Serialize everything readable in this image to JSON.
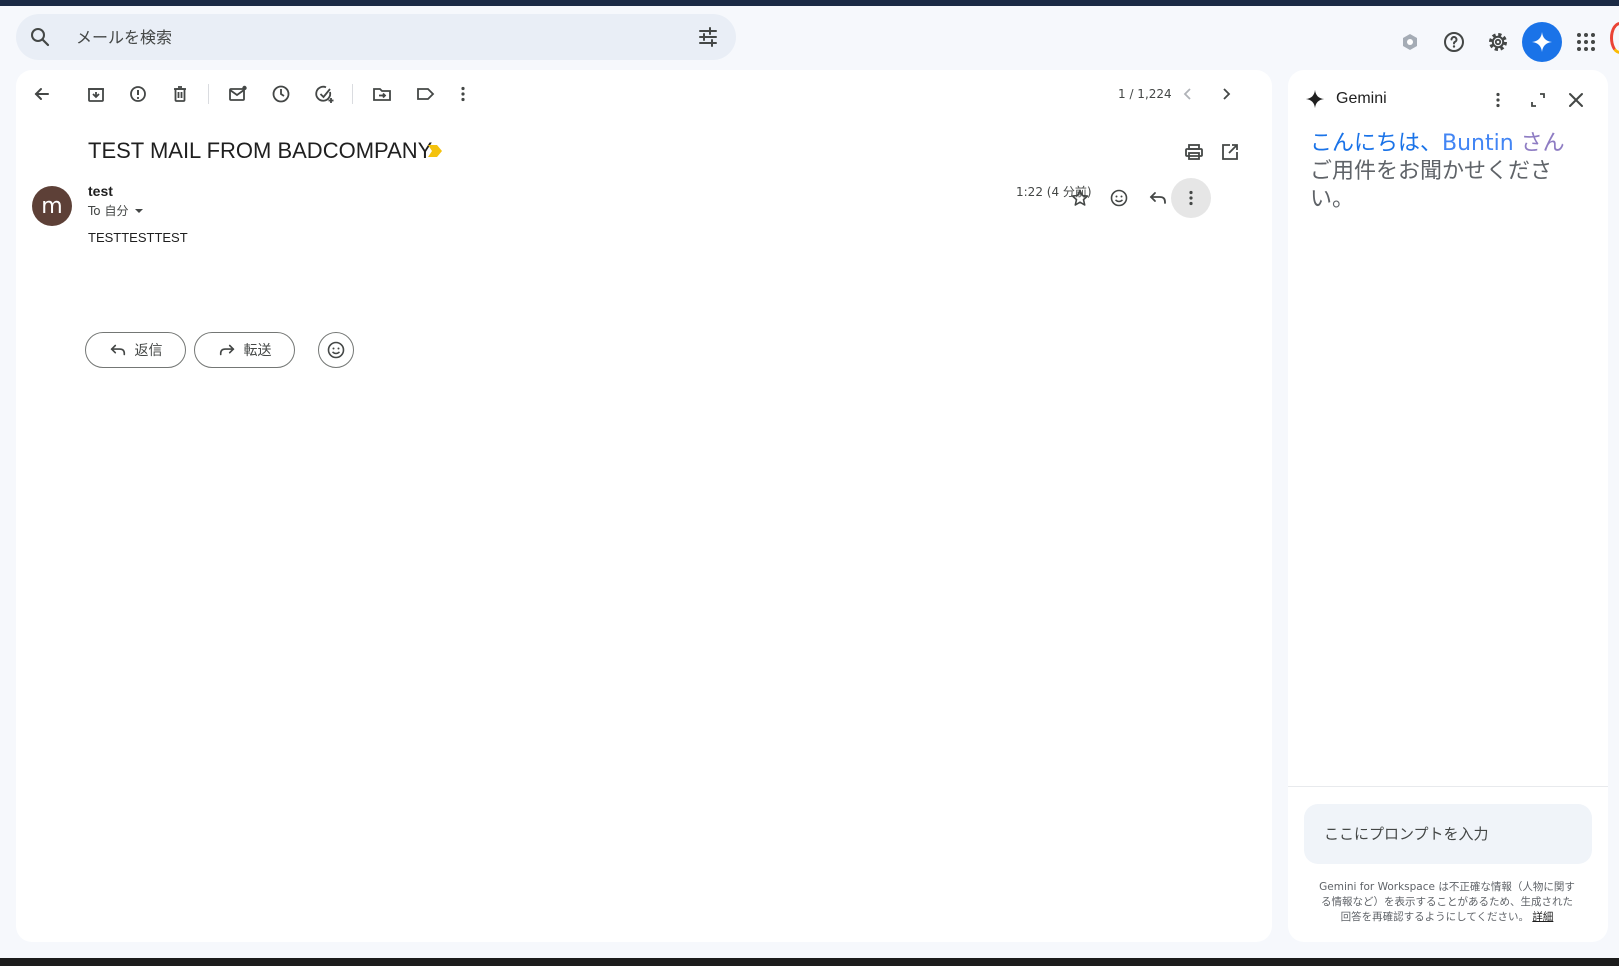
{
  "search": {
    "placeholder": "メールを検索"
  },
  "toolbar": {
    "pager": "1 / 1,224"
  },
  "email": {
    "subject": "TEST MAIL FROM BADCOMPANY",
    "sender_initial": "m",
    "sender_name": "test",
    "to": "To 自分",
    "time": "1:22 (4 分前)",
    "body": "TESTTESTTEST"
  },
  "actions": {
    "reply": "返信",
    "forward": "転送"
  },
  "gemini": {
    "title": "Gemini",
    "greeting_part1": "こんにちは、",
    "greeting_name": "Buntin",
    "greeting_suffix": " さん",
    "greeting_line2": "ご用件をお聞かせください。",
    "prompt_placeholder": "ここにプロンプトを入力",
    "disclaimer_bold": "Gemini for Workspace",
    "disclaimer_text": " は不正確な情報（人物に関する情報など）を表示することがあるため、生成された回答を再確認するようにしてください。",
    "disclaimer_link": "詳細"
  },
  "colors": {
    "accent": "#1a73e8",
    "avatar": "#5d4037",
    "label_tag": "#f4c20d"
  }
}
